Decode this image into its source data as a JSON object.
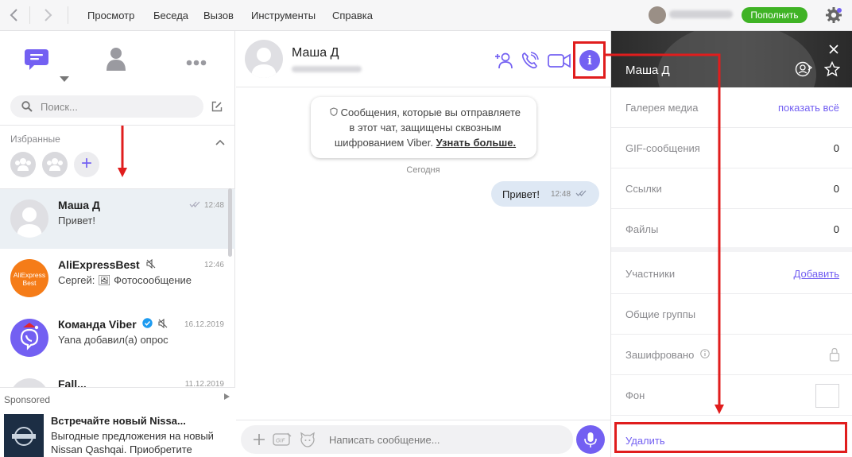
{
  "topbar": {
    "back_icon": "chevron-left-icon",
    "forward_icon": "chevron-right-icon",
    "menu": [
      {
        "label": "Просмотр"
      },
      {
        "label": "Беседа"
      },
      {
        "label": "Вызов"
      },
      {
        "label": "Инструменты"
      },
      {
        "label": "Справка"
      }
    ],
    "topup_label": "Пополнить",
    "settings_icon": "gear-icon"
  },
  "sidebar": {
    "tabs": [
      "chats-icon",
      "contacts-icon",
      "more-icon"
    ],
    "search_placeholder": "Поиск...",
    "favorites_title": "Избранные",
    "chats": [
      {
        "name": "Маша Д",
        "last": "Привет!",
        "time": "12:48",
        "status": "read-checkmarks"
      },
      {
        "name": "AliExpressBest",
        "last": "Сергей: 🖼 Фотосообщение",
        "time": "12:46",
        "avatar_text": "AliExpress Best",
        "muted": true
      },
      {
        "name": "Команда Viber",
        "last": "Yana добавил(а) опрос",
        "time": "16.12.2019",
        "verified": true,
        "muted": true
      },
      {
        "name": "Fall...",
        "last": "",
        "time": "11.12.2019"
      }
    ]
  },
  "sponsored": {
    "label": "Sponsored",
    "title": "Встречайте новый Nissa...",
    "desc_line1": "Выгодные предложения на новый",
    "desc_line2": "Nissan Qashqai. Приобретите"
  },
  "conversation": {
    "contact_name": "Маша Д",
    "e2e_line1": "Сообщения, которые вы отправляете",
    "e2e_line2": "в этот чат, защищены сквозным",
    "e2e_line3_plain": "шифрованием Viber.",
    "e2e_link": "Узнать больше.",
    "date_divider": "Сегодня",
    "message": {
      "text": "Привет!",
      "time": "12:48"
    },
    "composer_placeholder": "Написать сообщение...",
    "colors": {
      "accent": "#7360f2",
      "bubble": "#dee8f4"
    }
  },
  "info_panel": {
    "contact_name": "Маша Д",
    "media_gallery": {
      "label": "Галерея медиа",
      "action": "показать всё"
    },
    "gif": {
      "label": "GIF-сообщения",
      "value": "0"
    },
    "links": {
      "label": "Ссылки",
      "value": "0"
    },
    "files": {
      "label": "Файлы",
      "value": "0"
    },
    "members": {
      "label": "Участники",
      "action": "Добавить"
    },
    "common_groups": {
      "label": "Общие группы"
    },
    "encrypted": {
      "label": "Зашифровано"
    },
    "background": {
      "label": "Фон"
    },
    "delete_label": "Удалить"
  },
  "annotation_color": "#e01d1d"
}
